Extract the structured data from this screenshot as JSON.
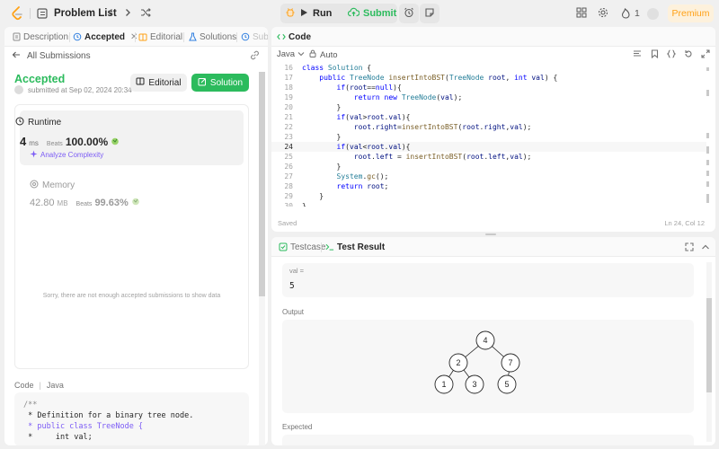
{
  "topbar": {
    "problem_list": "Problem List",
    "run_label": "Run",
    "submit_label": "Submit",
    "streak_count": "1",
    "premium_label": "Premium"
  },
  "left_tabs": {
    "description": "Description",
    "accepted": "Accepted",
    "editorial": "Editorial",
    "solutions": "Solutions",
    "submissions": "Sub"
  },
  "submission": {
    "all_submissions": "All Submissions",
    "status": "Accepted",
    "meta": "submitted at Sep 02, 2024 20:34",
    "editorial_button": "Editorial",
    "solution_button": "Solution",
    "runtime": {
      "label": "Runtime",
      "value": "4",
      "unit": "ms",
      "beats_label": "Beats",
      "beats_pct": "100.00%"
    },
    "analyze": "Analyze Complexity",
    "memory": {
      "label": "Memory",
      "value": "42.80",
      "unit": "MB",
      "beats_label": "Beats",
      "beats_pct": "99.63%"
    },
    "notice": "Sorry, there are not enough accepted submissions to show data",
    "code_label": "Code",
    "code_lang": "Java",
    "code_preview": [
      "/**",
      " * Definition for a binary tree node.",
      " * public class TreeNode {",
      " *     int val;"
    ]
  },
  "editor": {
    "title": "Code",
    "language": "Java",
    "mode": "Auto",
    "saved": "Saved",
    "cursor": "Ln 24, Col 12",
    "lines": [
      {
        "n": "16",
        "t": "class Solution {"
      },
      {
        "n": "17",
        "t": "    public TreeNode insertIntoBST(TreeNode root, int val) {"
      },
      {
        "n": "18",
        "t": "        if(root==null){"
      },
      {
        "n": "19",
        "t": "            return new TreeNode(val);"
      },
      {
        "n": "20",
        "t": "        }"
      },
      {
        "n": "21",
        "t": "        if(val>root.val){"
      },
      {
        "n": "22",
        "t": "            root.right=insertIntoBST(root.right,val);"
      },
      {
        "n": "23",
        "t": "        }"
      },
      {
        "n": "24",
        "t": "        if(val<root.val){"
      },
      {
        "n": "25",
        "t": "            root.left = insertIntoBST(root.left,val);"
      },
      {
        "n": "26",
        "t": "        }"
      },
      {
        "n": "27",
        "t": "        System.gc();"
      },
      {
        "n": "28",
        "t": "        return root;"
      },
      {
        "n": "29",
        "t": "    }"
      },
      {
        "n": "30",
        "t": "}"
      }
    ]
  },
  "results": {
    "testcase_tab": "Testcase",
    "result_tab": "Test Result",
    "case_name": "val =",
    "case_value": "5",
    "output_label": "Output",
    "expected_label": "Expected",
    "tree_nodes": [
      "4",
      "2",
      "7",
      "1",
      "3",
      "5"
    ]
  },
  "colors": {
    "accent_green": "#2cbb5d",
    "premium_orange": "#ffa116",
    "analyze_purple": "#7c5cf5"
  }
}
